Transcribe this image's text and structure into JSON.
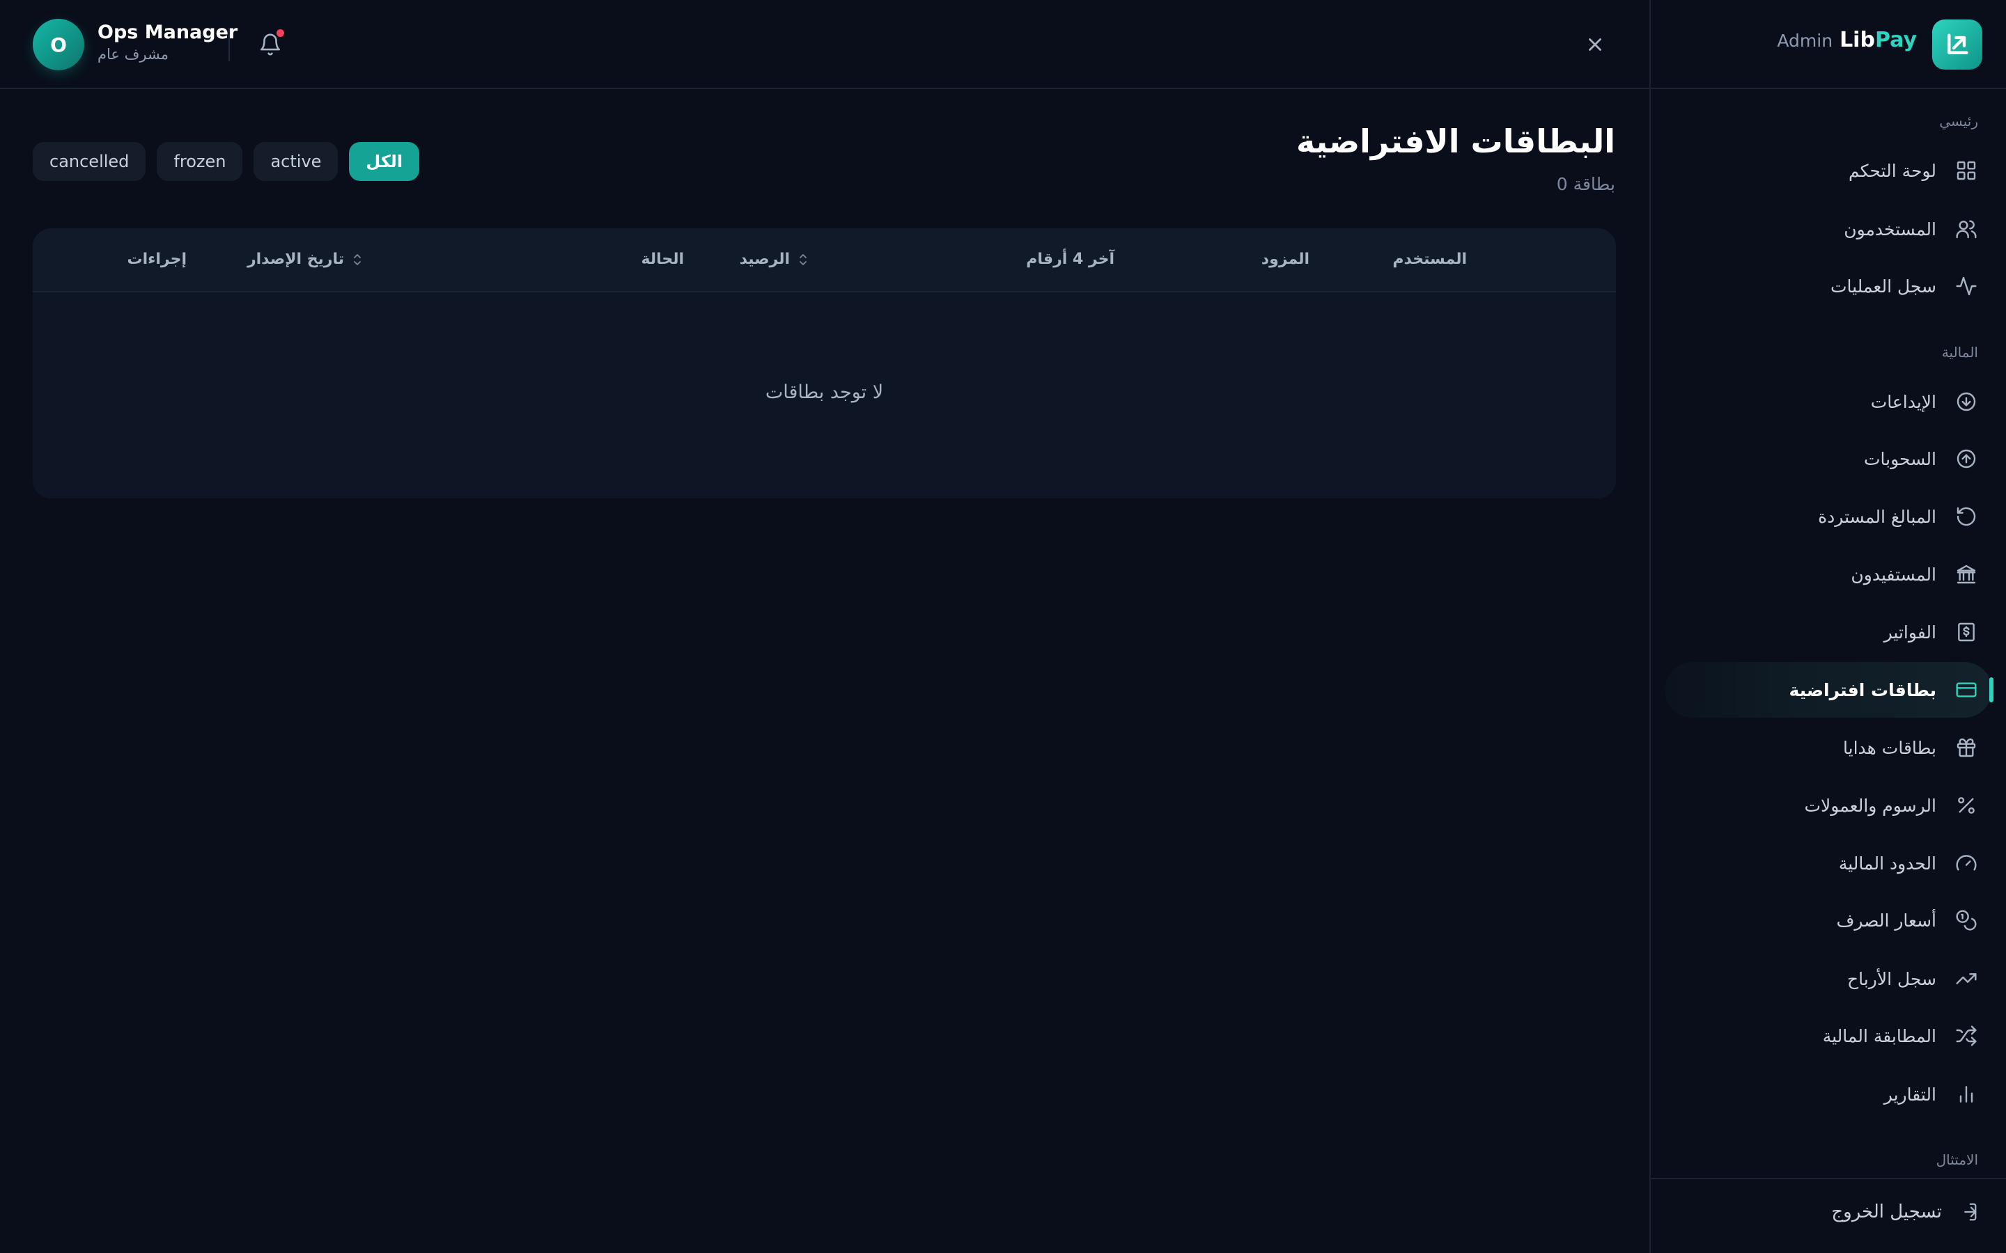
{
  "brand": {
    "lib": "Lib",
    "pay": "Pay",
    "admin": "Admin",
    "logo_icon": "arrow-up-right-icon"
  },
  "header": {
    "user_name": "Ops Manager",
    "user_role": "مشرف عام",
    "avatar_initial": "O",
    "bell_icon": "bell-icon",
    "close_icon": "close-icon"
  },
  "sidebar": {
    "sections": [
      {
        "label": "رئيسي"
      },
      {
        "label": "المالية"
      },
      {
        "label": "الامتثال"
      }
    ],
    "items": [
      {
        "label": "لوحة التحكم",
        "icon": "grid-icon"
      },
      {
        "label": "المستخدمون",
        "icon": "users-icon"
      },
      {
        "label": "سجل العمليات",
        "icon": "activity-icon"
      },
      {
        "label": "الإيداعات",
        "icon": "arrow-down-circle-icon"
      },
      {
        "label": "السحوبات",
        "icon": "arrow-up-circle-icon"
      },
      {
        "label": "المبالغ المستردة",
        "icon": "rotate-ccw-icon"
      },
      {
        "label": "المستفيدون",
        "icon": "bank-icon"
      },
      {
        "label": "الفواتير",
        "icon": "receipt-dollar-icon"
      },
      {
        "label": "بطاقات افتراضية",
        "icon": "credit-card-icon",
        "active": true
      },
      {
        "label": "بطاقات هدايا",
        "icon": "gift-icon"
      },
      {
        "label": "الرسوم والعمولات",
        "icon": "percent-icon"
      },
      {
        "label": "الحدود المالية",
        "icon": "gauge-icon"
      },
      {
        "label": "أسعار الصرف",
        "icon": "coins-icon"
      },
      {
        "label": "سجل الأرباح",
        "icon": "trending-up-icon"
      },
      {
        "label": "المطابقة المالية",
        "icon": "shuffle-icon"
      },
      {
        "label": "التقارير",
        "icon": "bar-chart-icon"
      }
    ],
    "logout_label": "تسجيل الخروج",
    "logout_icon": "log-out-icon"
  },
  "page": {
    "title": "البطاقات الافتراضية",
    "subtitle": "0 بطاقة"
  },
  "filters": [
    {
      "label": "الكل",
      "active": true
    },
    {
      "label": "active"
    },
    {
      "label": "frozen"
    },
    {
      "label": "cancelled"
    }
  ],
  "table": {
    "columns": [
      {
        "label": "المستخدم"
      },
      {
        "label": "المزود"
      },
      {
        "label": "آخر 4 أرقام"
      },
      {
        "label": "الرصيد",
        "sortable": true
      },
      {
        "label": "الحالة"
      },
      {
        "label": "تاريخ الإصدار",
        "sortable": true
      },
      {
        "label": "إجراءات"
      }
    ],
    "empty_text": "لا توجد بطاقات"
  },
  "colors": {
    "accent": "#2dd4bf",
    "accent_dark": "#14a394",
    "background": "#090e1a",
    "alert": "#f43f5e"
  }
}
